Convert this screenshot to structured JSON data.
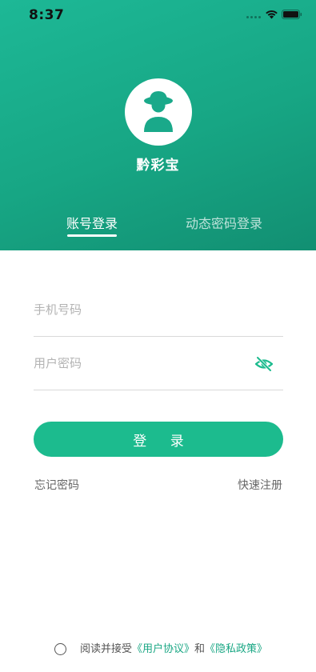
{
  "status_bar": {
    "time": "8:37"
  },
  "app": {
    "name": "黔彩宝"
  },
  "tabs": [
    {
      "label": "账号登录",
      "active": true
    },
    {
      "label": "动态密码登录",
      "active": false
    }
  ],
  "form": {
    "phone_placeholder": "手机号码",
    "password_placeholder": "用户密码",
    "password_visibility_icon": "eye-off-icon"
  },
  "actions": {
    "login_label": "登 录",
    "forgot_password": "忘记密码",
    "quick_register": "快速注册"
  },
  "agreement": {
    "prefix": "阅读并接受",
    "user_agreement": "《用户协议》",
    "conjunction": "和",
    "privacy_policy": "《隐私政策》",
    "checked": false
  },
  "colors": {
    "brand": "#1cbb8e",
    "header_gradient_start": "#1db896",
    "header_gradient_end": "#128f72",
    "link": "#1aa784"
  }
}
